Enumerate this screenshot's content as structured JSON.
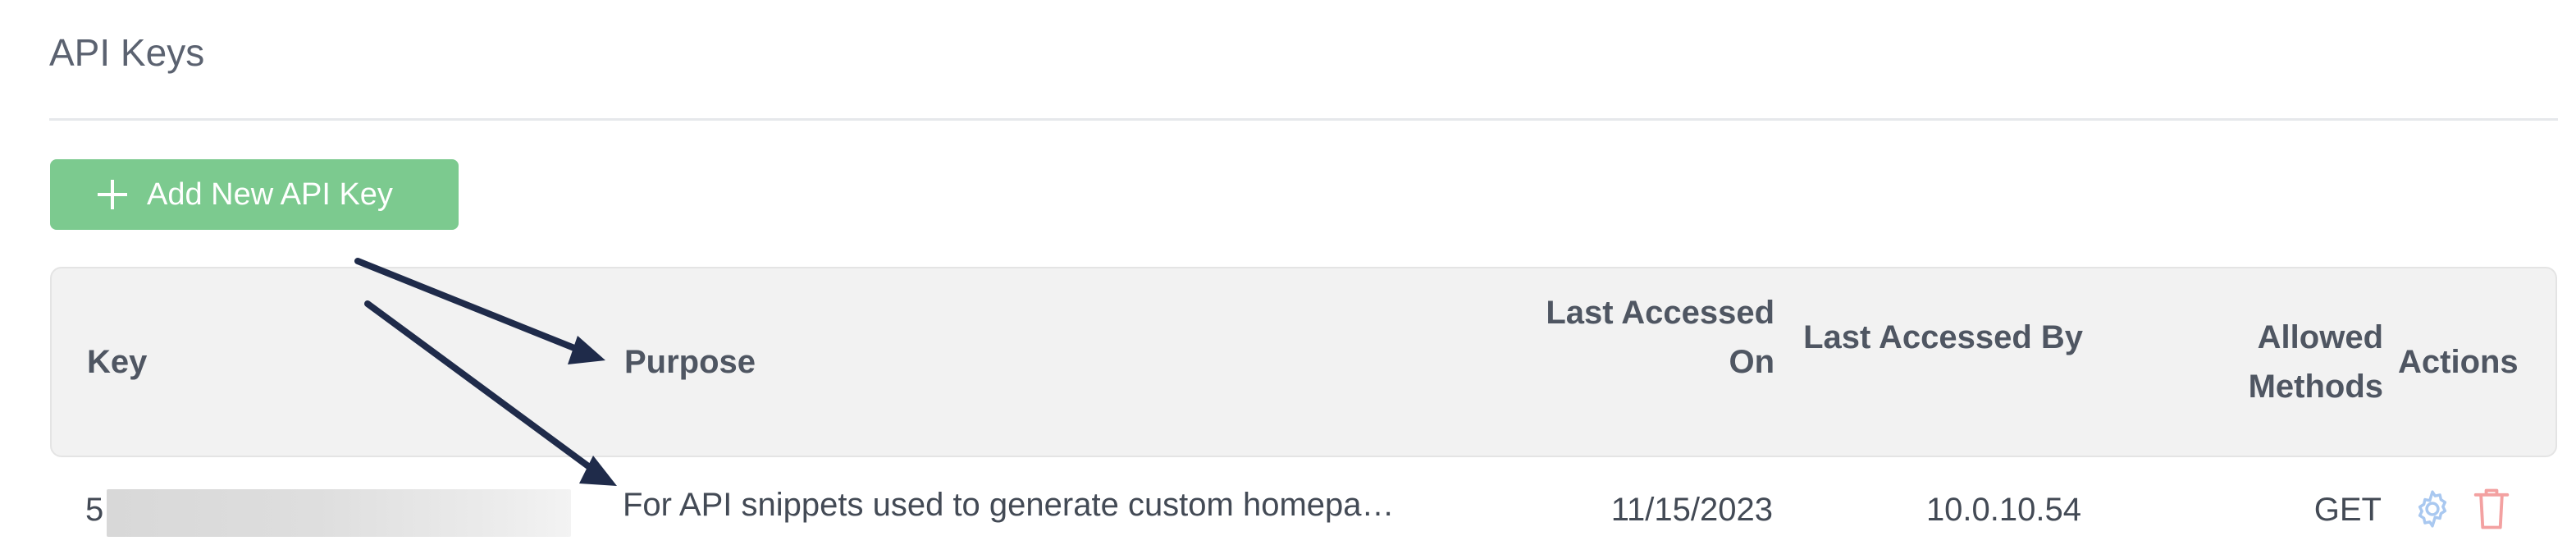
{
  "page": {
    "title": "API Keys"
  },
  "toolbar": {
    "add_button_label": "Add New API Key",
    "add_icon": "plus-icon"
  },
  "table": {
    "columns": {
      "key": "Key",
      "purpose": "Purpose",
      "last_accessed_on": "Last Accessed On",
      "last_accessed_by": "Last Accessed By",
      "allowed_methods": "Allowed Methods",
      "actions": "Actions"
    },
    "rows": [
      {
        "key_prefix": "5",
        "key_redacted": true,
        "purpose": "For API snippets used to generate custom homepa…",
        "last_accessed_on": "11/15/2023",
        "last_accessed_by": "10.0.10.54",
        "allowed_methods": "GET",
        "actions": [
          "gear-icon",
          "trash-icon"
        ]
      }
    ]
  },
  "colors": {
    "primary_button": "#7cca8f",
    "header_background": "#f2f2f2",
    "annotation_arrow": "#1f2b4a",
    "settings_icon": "#a9c8f0",
    "delete_icon": "#f3a1a1"
  }
}
